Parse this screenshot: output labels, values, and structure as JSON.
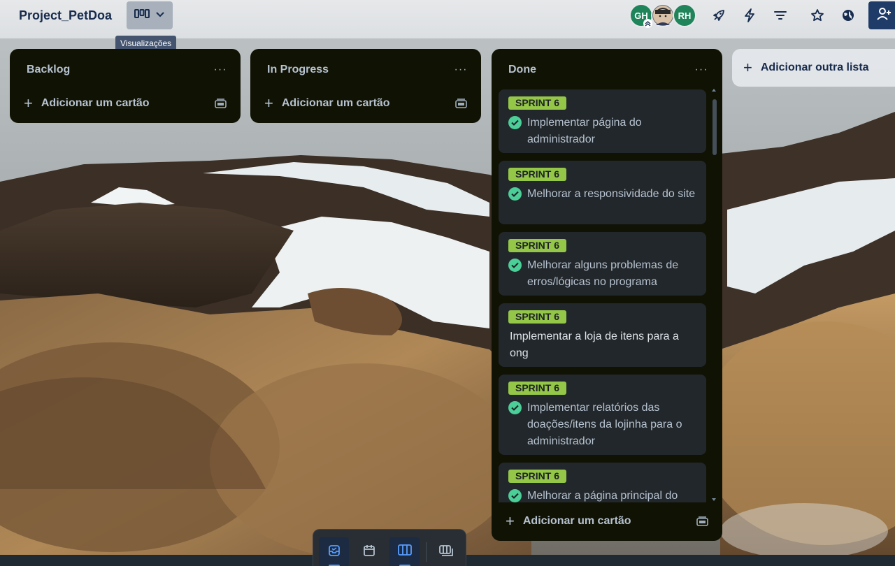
{
  "header": {
    "board_title": "Project_PetDoa",
    "views_tooltip": "Visualizações",
    "members": [
      {
        "initials": "GH",
        "color": "#1f845a"
      },
      {
        "initials": "",
        "color": "#5a6472"
      },
      {
        "initials": "RH",
        "color": "#1f845a"
      }
    ],
    "icons": [
      "power-ups-icon",
      "automation-icon",
      "filter-icon",
      "star-icon",
      "visibility-icon",
      "share-icon"
    ]
  },
  "lists": [
    {
      "title": "Backlog",
      "menu": "···",
      "add_card": "Adicionar um cartão",
      "cards": []
    },
    {
      "title": "In Progress",
      "menu": "···",
      "add_card": "Adicionar um cartão",
      "cards": []
    },
    {
      "title": "Done",
      "menu": "···",
      "add_card": "Adicionar um cartão",
      "cards": [
        {
          "label": "SPRINT 6",
          "title": "Implementar página do administrador",
          "done": true
        },
        {
          "label": "SPRINT 6",
          "title": "Melhorar a responsividade do site",
          "done": true
        },
        {
          "label": "SPRINT 6",
          "title": "Melhorar alguns problemas de erros/lógicas no programa",
          "done": true
        },
        {
          "label": "SPRINT 6",
          "title": "Implementar a loja de itens para a ong",
          "done": false
        },
        {
          "label": "SPRINT 6",
          "title": "Implementar relatórios das doações/itens da lojinha para o administrador",
          "done": true
        },
        {
          "label": "SPRINT 6",
          "title": "Melhorar a página principal do",
          "done": true
        }
      ]
    }
  ],
  "add_list": "Adicionar outra lista",
  "colors": {
    "label_green": "#94c748",
    "check_green": "#4bce97",
    "list_bg": "#101204",
    "card_bg": "#22272b",
    "accent_blue": "#579dff"
  },
  "switcher": {
    "buttons": [
      "inbox-icon",
      "planner-icon",
      "board-icon",
      "switch-boards-icon"
    ],
    "active": [
      "inbox-icon",
      "board-icon"
    ]
  }
}
